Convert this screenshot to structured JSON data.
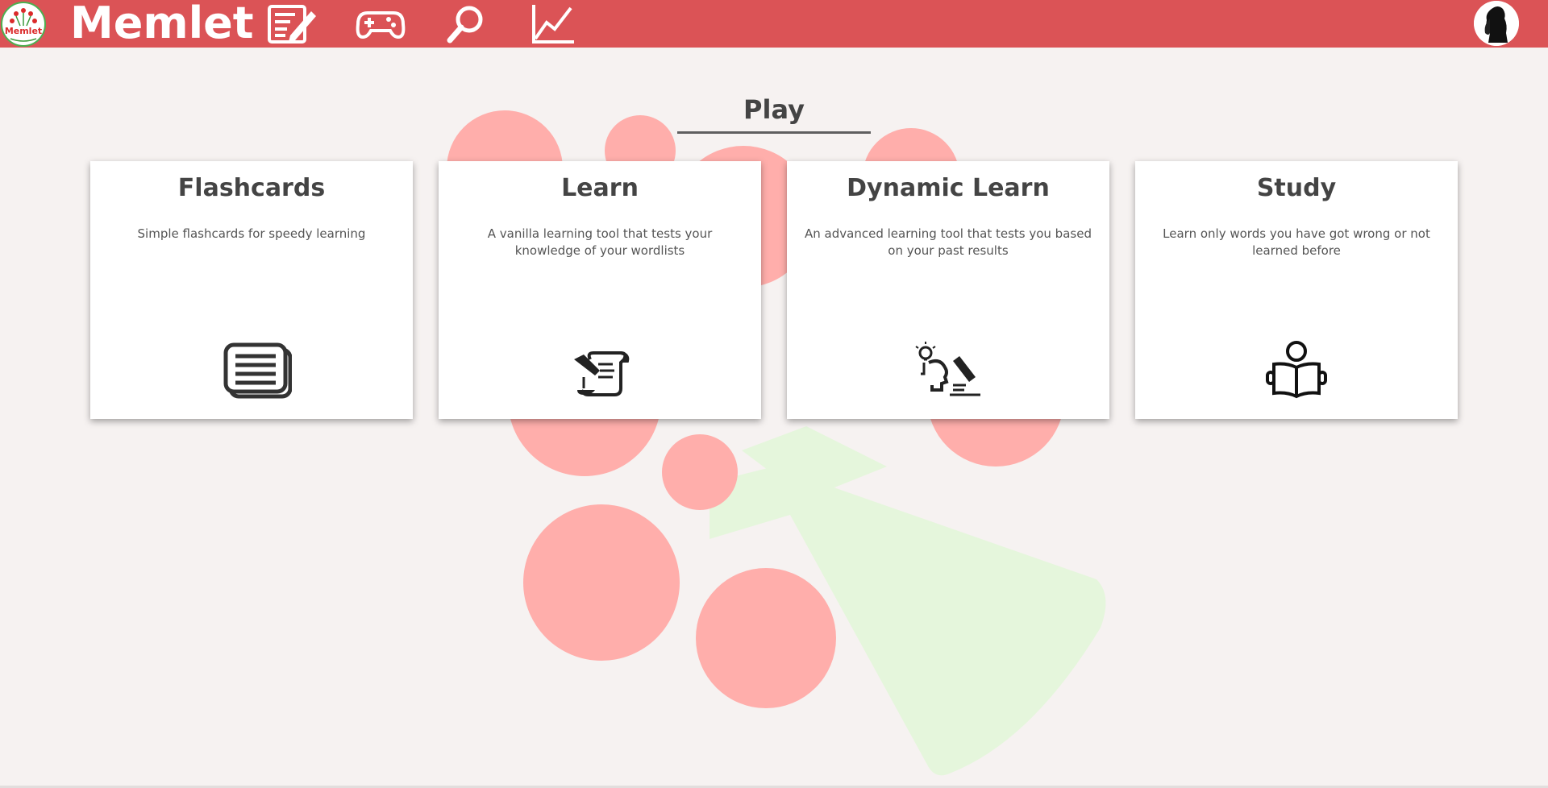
{
  "navbar": {
    "brand": "Memlet",
    "logo_text": "Memlet",
    "icons": [
      "edit-wordlist-icon",
      "gamepad-icon",
      "search-icon",
      "chart-icon"
    ],
    "bg_color": "#db5356"
  },
  "page": {
    "title": "Play"
  },
  "cards": [
    {
      "title": "Flashcards",
      "description": "Simple flashcards for speedy learning",
      "icon": "flashcards-icon"
    },
    {
      "title": "Learn",
      "description": "A vanilla learning tool that tests your knowledge of your wordlists",
      "icon": "scroll-quill-icon"
    },
    {
      "title": "Dynamic Learn",
      "description": "An advanced learning tool that tests you based on your past results",
      "icon": "brain-idea-icon"
    },
    {
      "title": "Study",
      "description": "Learn only words you have got wrong or not learned before",
      "icon": "person-reading-icon"
    }
  ],
  "colors": {
    "accent": "#db5356",
    "background": "#f6f2f1",
    "circle": "#ffaeab",
    "leaf": "#e5f6dc"
  }
}
